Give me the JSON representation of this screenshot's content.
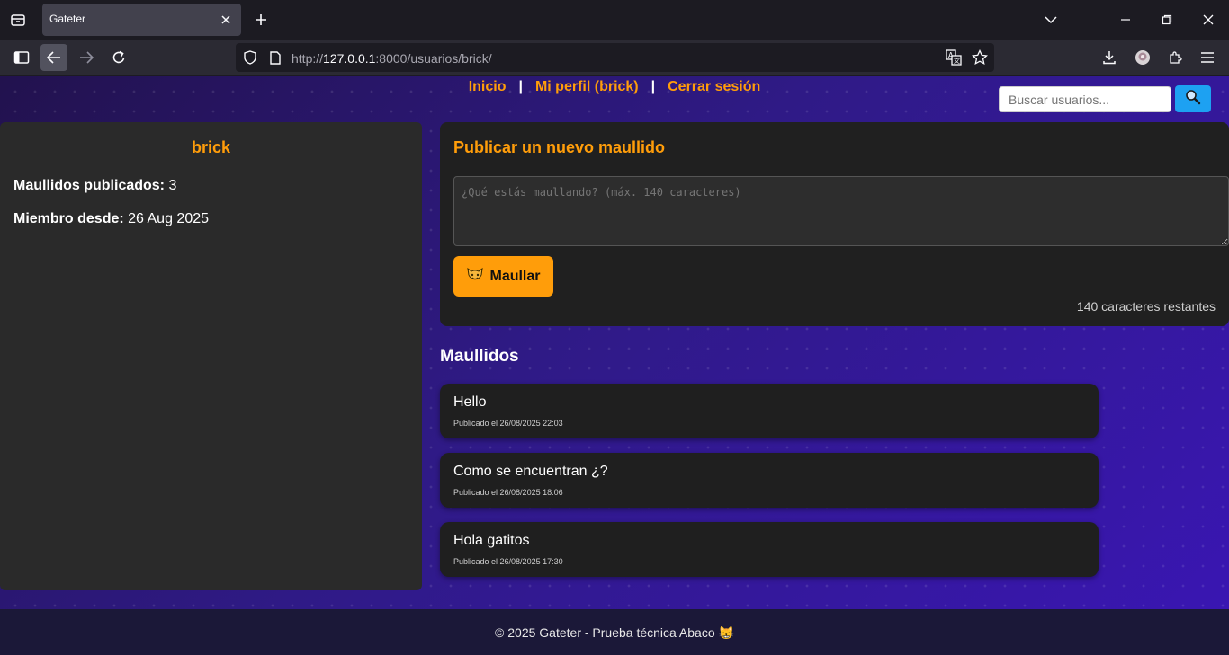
{
  "browser": {
    "tab_title": "Gateter",
    "url_host": "127.0.0.1",
    "url_rest": ":8000/usuarios/brick/",
    "url_scheme": "http://"
  },
  "nav": {
    "home": "Inicio",
    "separator": "|",
    "profile": "Mi perfil (brick)",
    "logout": "Cerrar sesión"
  },
  "search": {
    "placeholder": "Buscar usuarios...",
    "button_icon": "magnifier-icon"
  },
  "profile": {
    "username": "brick",
    "posts_label": "Maullidos publicados:",
    "posts_count": "3",
    "member_label": "Miembro desde:",
    "member_since": "26 Aug 2025"
  },
  "compose": {
    "title": "Publicar un nuevo maullido",
    "placeholder": "¿Qué estás maullando? (máx. 140 caracteres)",
    "button_label": "Maullar",
    "button_icon": "cat-face-icon",
    "char_count": "140 caracteres restantes"
  },
  "feed": {
    "title": "Maullidos",
    "posts": [
      {
        "text": "Hello",
        "date": "Publicado el 26/08/2025 22:03"
      },
      {
        "text": "Como se encuentran ¿?",
        "date": "Publicado el 26/08/2025 18:06"
      },
      {
        "text": "Hola gatitos",
        "date": "Publicado el 26/08/2025 17:30"
      }
    ]
  },
  "footer": {
    "text": "© 2025 Gateter - Prueba técnica Abaco 😸"
  },
  "colors": {
    "accent": "#ff9d0a",
    "search_button": "#1da1f2",
    "card_bg": "#2a2a2a"
  }
}
